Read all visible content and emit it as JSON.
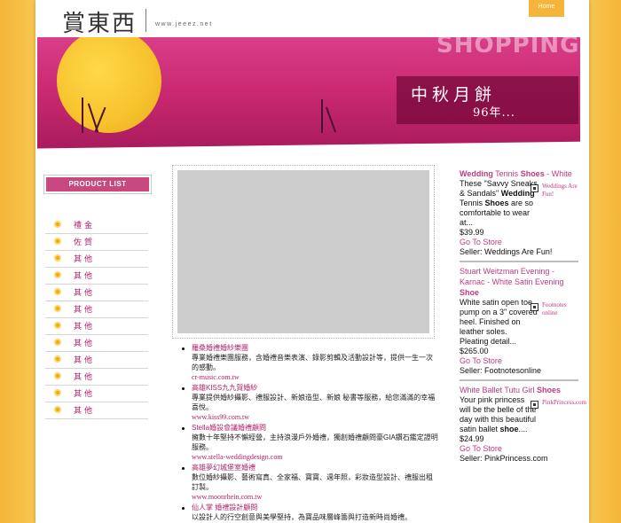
{
  "header": {
    "logo_text": "賞東西",
    "site_url": "www.jeeez.net",
    "home_label": "Home"
  },
  "banner": {
    "watermark": "SHOPPING",
    "title": "中秋月餅",
    "subtitle": "96年..."
  },
  "sidebar": {
    "heading": "PRODUCT LIST",
    "items": [
      "禮金",
      "佐賀",
      "其他",
      "其他",
      "其他",
      "其他",
      "其他",
      "其他",
      "其他",
      "其他",
      "其他",
      "其他"
    ]
  },
  "ads": [
    {
      "title": "羅桑婚禮婚紗樂團",
      "desc": "專業婚禮樂團服務，含婚禮音樂表演、錄影剪輯及活動設計等，提供一生一次的感動。",
      "url": "cr-music.com.tw"
    },
    {
      "title": "高雄KISS九九賀婚紗",
      "desc": "專業提供婚紗攝影、禮服設計、新娘造型、新娘 秘書等服務，給您滿滿的幸福喜悅。",
      "url": "www.kiss99.com.tw"
    },
    {
      "title": "Stella婚設會議婚禮顧問",
      "desc": "擁數十年堅持不懈經營，主持浪漫戶外婚禮，獨創婚禮顧問豪GIA鑽石鑑定證明服務。",
      "url": "www.stella-weddingdesign.com"
    },
    {
      "title": "高雄夢幻城堡室婚禮",
      "desc": "數位婚紗攝影、藝術寫真、全家福、寶寶、週年照，彩妝造型設計、禮服出租訂製。",
      "url": "www.moonrhein.com.tw"
    },
    {
      "title": "仙人掌 婚禮設計顧問",
      "desc": "以設計人的行空創意與美學堅持，為寶品味層峰籌與打造新時尚婚禮。",
      "url": ""
    }
  ],
  "products": [
    {
      "title_pre": "Wedding",
      "title_mid": " Tennis ",
      "title_bold": "Shoes",
      "title_post": " - White",
      "desc_html_parts": [
        "These \"Savvy Sneaks & Sandals\" ",
        "Wedding",
        " Tennis ",
        "Shoes",
        " are so comfortable to wear at..."
      ],
      "price": "$39.99",
      "store_link": "Go To Store",
      "seller": "Seller: Weddings Are Fun!",
      "logo_name": "Weddings Are Fun!"
    },
    {
      "title_pre": "Stuart Weitzman Evening - Karnac - White Satin Evening ",
      "title_mid": "",
      "title_bold": "Shoe",
      "title_post": "",
      "desc_html_parts": [
        "White satin open toe pump on a 3\" covered heel. Finished on leather soles. Pleating detail...",
        "",
        "",
        "",
        ""
      ],
      "price": "$265.00",
      "store_link": "Go To Store",
      "seller": "Seller: Footnotesonline",
      "logo_name": "Footnotes online"
    },
    {
      "title_pre": "White Ballet Tutu Girl ",
      "title_mid": "",
      "title_bold": "Shoes",
      "title_post": "",
      "desc_html_parts": [
        "Your pink princess will be the belle of the day with this beautiful satin ballet ",
        "shoe",
        "....",
        "",
        ""
      ],
      "price": "$24.99",
      "store_link": "Go To Store",
      "seller": "Seller: PinkPrincess.com",
      "logo_name": "PinkPrincess.com"
    }
  ],
  "colors": {
    "accent": "#c03a84",
    "banner": "#cc2a73",
    "sun": "#f7c22b",
    "home_tab": "#f5b53a"
  }
}
